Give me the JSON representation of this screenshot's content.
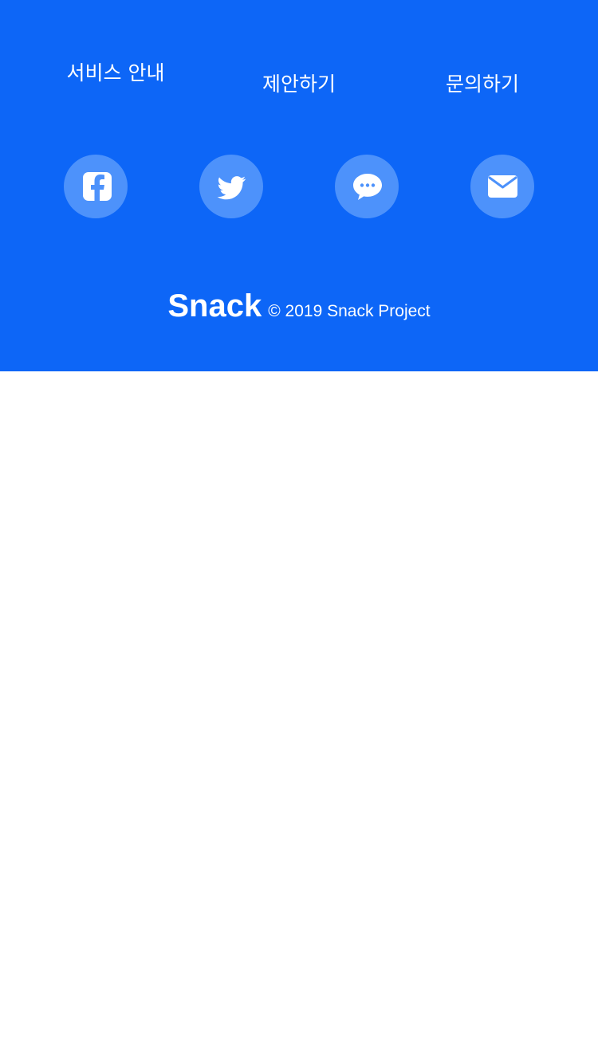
{
  "footer": {
    "background": "#0d66f7",
    "nav": {
      "service": "서비스 안내",
      "suggest": "제안하기",
      "inquiry": "문의하기"
    },
    "social": [
      {
        "icon": "facebook-icon"
      },
      {
        "icon": "twitter-icon"
      },
      {
        "icon": "kakaotalk-icon"
      },
      {
        "icon": "mail-icon"
      }
    ],
    "brand": {
      "logo": "Snack",
      "copyright": "© 2019 Snack Project"
    }
  }
}
